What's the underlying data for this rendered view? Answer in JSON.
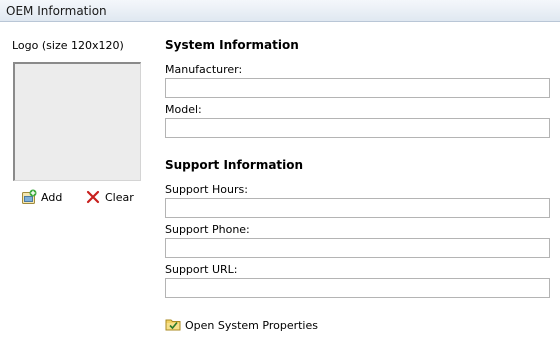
{
  "window": {
    "title": "OEM Information"
  },
  "logo": {
    "label": "Logo (size 120x120)",
    "add_label": "Add",
    "clear_label": "Clear"
  },
  "system_info": {
    "heading": "System Information",
    "fields": [
      {
        "label": "Manufacturer:",
        "value": ""
      },
      {
        "label": "Model:",
        "value": ""
      }
    ]
  },
  "support_info": {
    "heading": "Support Information",
    "fields": [
      {
        "label": "Support Hours:",
        "value": ""
      },
      {
        "label": "Support Phone:",
        "value": ""
      },
      {
        "label": "Support URL:",
        "value": ""
      }
    ]
  },
  "actions": {
    "open_system_properties": "Open System Properties"
  },
  "icons": {
    "add": "add-image-icon",
    "clear": "red-x-icon",
    "open_properties": "folder-check-icon"
  },
  "colors": {
    "title_bar": "#e6edf5",
    "clear_icon": "#c8201e"
  }
}
